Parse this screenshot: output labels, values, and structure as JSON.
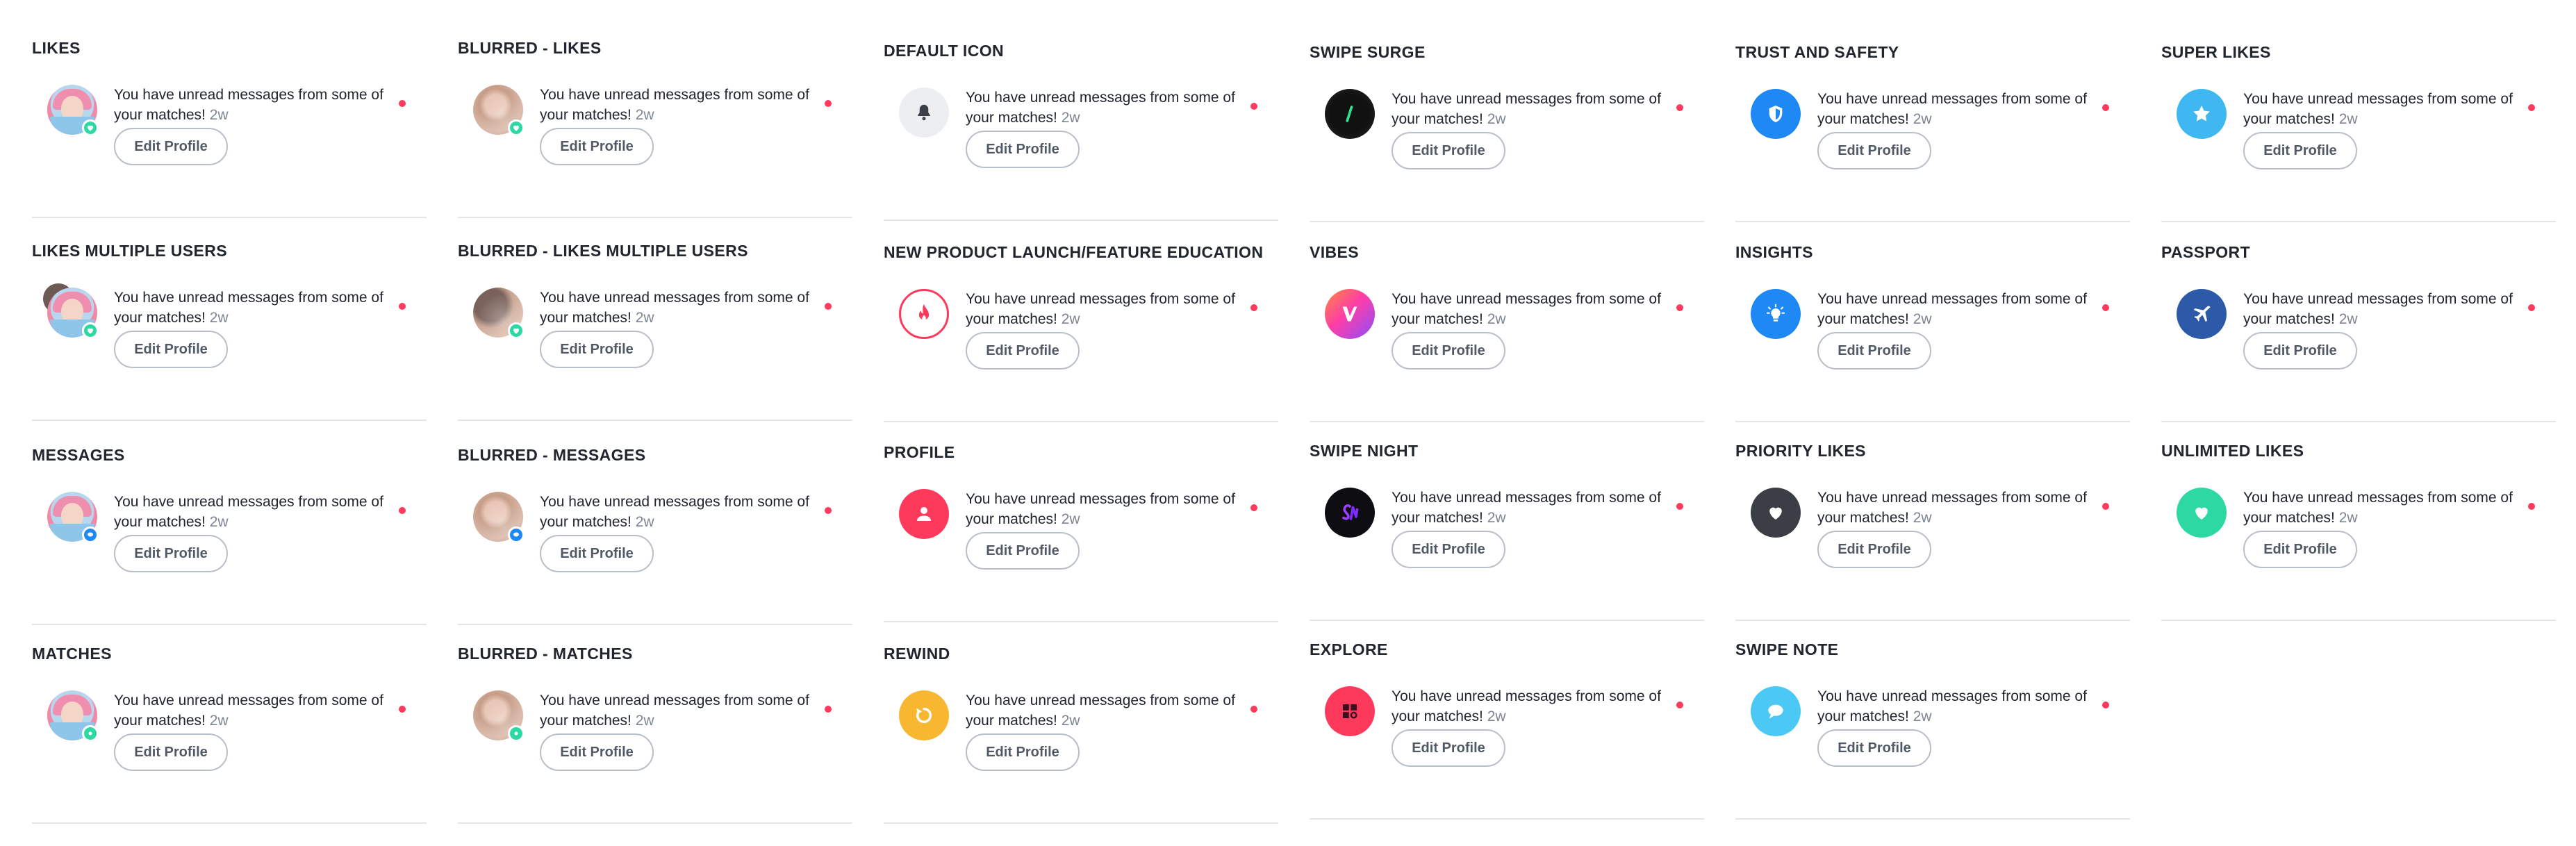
{
  "message_text": "You have unread messages from some of your matches!",
  "time_label": "2w",
  "button_label": "Edit Profile",
  "colors": {
    "unread_dot": "#fd3a5c",
    "badge_like": "#2dd8a3",
    "badge_message": "#1e88f5",
    "brand_red": "#fd3a5c"
  },
  "columns": [
    {
      "cards": [
        {
          "title": "LIKES",
          "icon": "profile-photo",
          "badge": "like-heart-badge"
        },
        {
          "title": "LIKES MULTIPLE USERS",
          "icon": "profile-photo-stack",
          "badge": "like-heart-badge"
        },
        {
          "title": "MESSAGES",
          "icon": "profile-photo",
          "badge": "message-badge"
        },
        {
          "title": "MATCHES",
          "icon": "profile-photo",
          "badge": "match-badge"
        }
      ]
    },
    {
      "cards": [
        {
          "title": "BLURRED - LIKES",
          "icon": "blurred-photo",
          "badge": "like-heart-badge"
        },
        {
          "title": "BLURRED - LIKES MULTIPLE USERS",
          "icon": "blurred-photo-stack",
          "badge": "like-heart-badge"
        },
        {
          "title": "BLURRED - MESSAGES",
          "icon": "blurred-photo",
          "badge": "message-badge"
        },
        {
          "title": "BLURRED - MATCHES",
          "icon": "blurred-photo",
          "badge": "match-badge"
        }
      ]
    },
    {
      "cards": [
        {
          "title": "DEFAULT ICON",
          "icon": "bell-icon"
        },
        {
          "title": "NEW PRODUCT LAUNCH/FEATURE EDUCATION",
          "icon": "flame-outline-icon"
        },
        {
          "title": "PROFILE",
          "icon": "person-icon"
        },
        {
          "title": "REWIND",
          "icon": "rewind-icon"
        }
      ]
    },
    {
      "cards": [
        {
          "title": "SWIPE SURGE",
          "icon": "swipe-surge-icon"
        },
        {
          "title": "VIBES",
          "icon": "vibes-icon"
        },
        {
          "title": "SWIPE NIGHT",
          "icon": "swipe-night-icon"
        },
        {
          "title": "EXPLORE",
          "icon": "explore-icon"
        }
      ]
    },
    {
      "cards": [
        {
          "title": "TRUST AND SAFETY",
          "icon": "shield-icon"
        },
        {
          "title": "INSIGHTS",
          "icon": "lightbulb-icon"
        },
        {
          "title": "PRIORITY LIKES",
          "icon": "heart-dark-icon"
        },
        {
          "title": "SWIPE NOTE",
          "icon": "speech-bubble-icon"
        }
      ]
    },
    {
      "cards": [
        {
          "title": "SUPER LIKES",
          "icon": "star-icon"
        },
        {
          "title": "PASSPORT",
          "icon": "airplane-icon"
        },
        {
          "title": "UNLIMITED LIKES",
          "icon": "heart-green-icon"
        }
      ]
    }
  ]
}
